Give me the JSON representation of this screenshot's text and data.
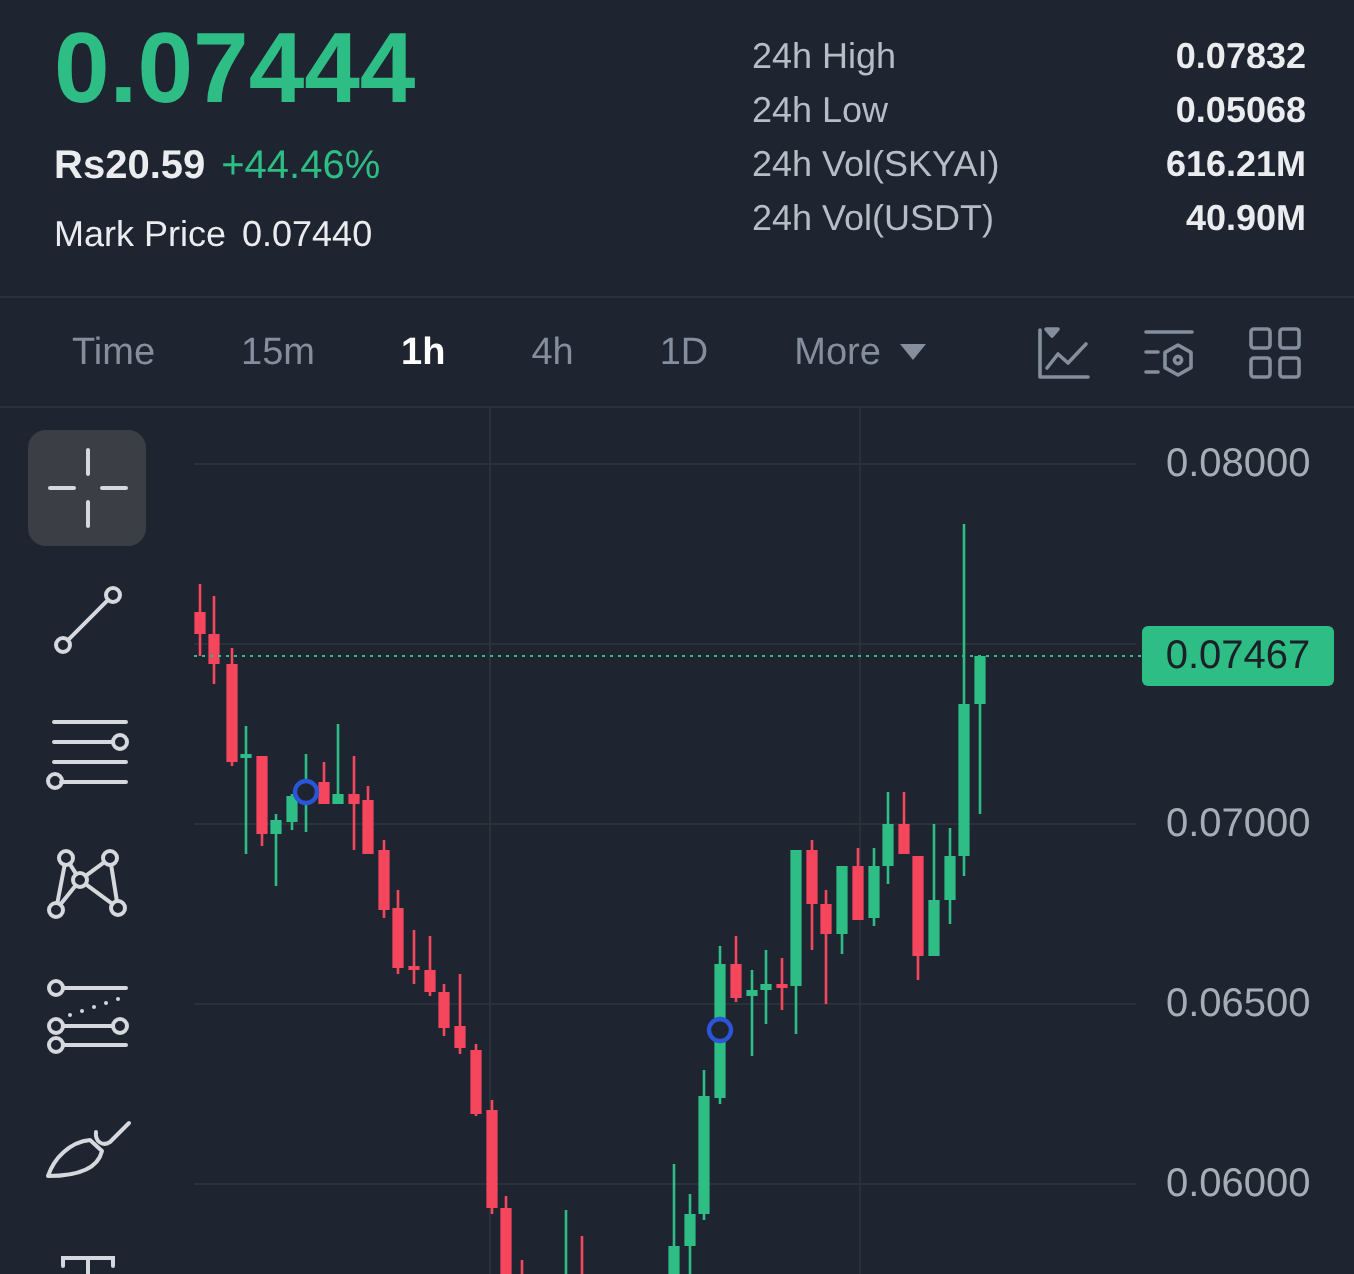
{
  "ticker": {
    "last_price": "0.07444",
    "local_price": "Rs20.59",
    "change": "+44.46%",
    "mark_price_label": "Mark Price",
    "mark_price": "0.07440"
  },
  "stats": [
    {
      "label": "24h High",
      "value": "0.07832"
    },
    {
      "label": "24h Low",
      "value": "0.05068"
    },
    {
      "label": "24h Vol(SKYAI)",
      "value": "616.21M"
    },
    {
      "label": "24h Vol(USDT)",
      "value": "40.90M"
    }
  ],
  "intervals": [
    {
      "label": "Time",
      "kind": "interval",
      "selected": false
    },
    {
      "label": "15m",
      "kind": "interval",
      "selected": false
    },
    {
      "label": "1h",
      "kind": "interval",
      "selected": true
    },
    {
      "label": "4h",
      "kind": "interval",
      "selected": false
    },
    {
      "label": "1D",
      "kind": "interval",
      "selected": false
    },
    {
      "label": "More",
      "kind": "dropdown",
      "selected": false
    }
  ],
  "drawing_tools": [
    {
      "selected": true
    },
    {
      "selected": false
    },
    {
      "selected": false
    },
    {
      "selected": false
    },
    {
      "selected": false
    },
    {
      "selected": false
    },
    {
      "selected": false
    }
  ],
  "chart": {
    "price_axis": [
      "0.08000",
      "0.07000",
      "0.06500",
      "0.06000"
    ],
    "last_price_tag": "0.07467"
  }
}
